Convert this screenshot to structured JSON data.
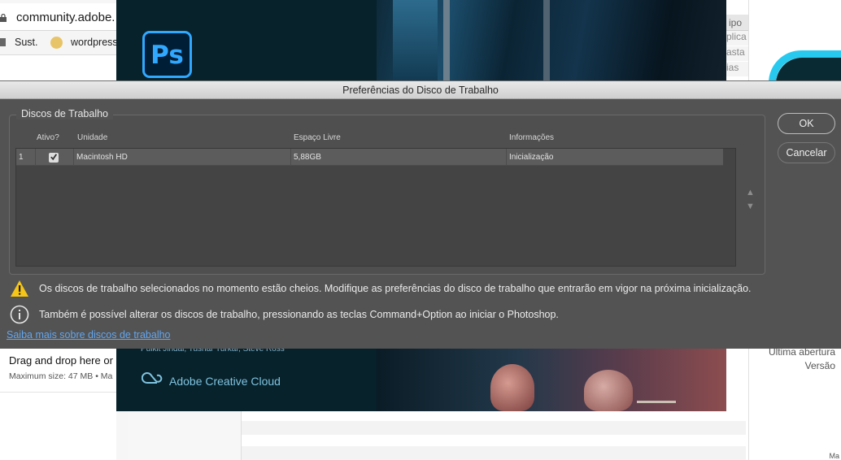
{
  "browser": {
    "url": "community.adobe.",
    "bookmarks": [
      "Sust.",
      "wordpress"
    ],
    "drop_text": "Drag and drop here or b",
    "max_size": "Maximum size: 47 MB • Ma"
  },
  "finder": {
    "column_header": "ipo",
    "rows": [
      "plica",
      "asta",
      "ias"
    ],
    "meta_last_opened": "Última abertura",
    "meta_version": "Versão",
    "bottom_text": "Ma"
  },
  "splash": {
    "app_icon_label": "Ps",
    "credits": "Pulkit Jindal, Tushar Turkar, Steve Ross",
    "cloud_label": "Adobe Creative Cloud"
  },
  "dialog": {
    "title": "Preferências do Disco de Trabalho",
    "group_label": "Discos de Trabalho",
    "columns": {
      "active": "Ativo?",
      "unit": "Unidade",
      "free_space": "Espaço Livre",
      "info": "Informações"
    },
    "rows": [
      {
        "index": "1",
        "active": true,
        "unit": "Macintosh HD",
        "free_space": "5,88GB",
        "info": "Inicialização"
      }
    ],
    "buttons": {
      "ok": "OK",
      "cancel": "Cancelar"
    },
    "arrows": {
      "up": "▲",
      "down": "▼"
    },
    "warning": "Os discos de trabalho selecionados no momento estão cheios. Modifique as preferências do disco de trabalho que entrarão em vigor na próxima inicialização.",
    "info": "Também é possível alterar os discos de trabalho, pressionando as teclas Command+Option ao iniciar o Photoshop.",
    "learn_more": "Saiba mais sobre discos de trabalho"
  },
  "colors": {
    "dialog_bg": "#535353",
    "ps_blue": "#31a8ff",
    "warning_yellow": "#f5c518",
    "link_blue": "#63a6ee"
  },
  "icons": [
    "lock-icon",
    "folder-icon",
    "wordpress-icon",
    "photoshop-app-icon",
    "creative-cloud-icon",
    "checkbox-checked-icon",
    "warning-icon",
    "info-icon",
    "arrow-up-icon",
    "arrow-down-icon"
  ]
}
